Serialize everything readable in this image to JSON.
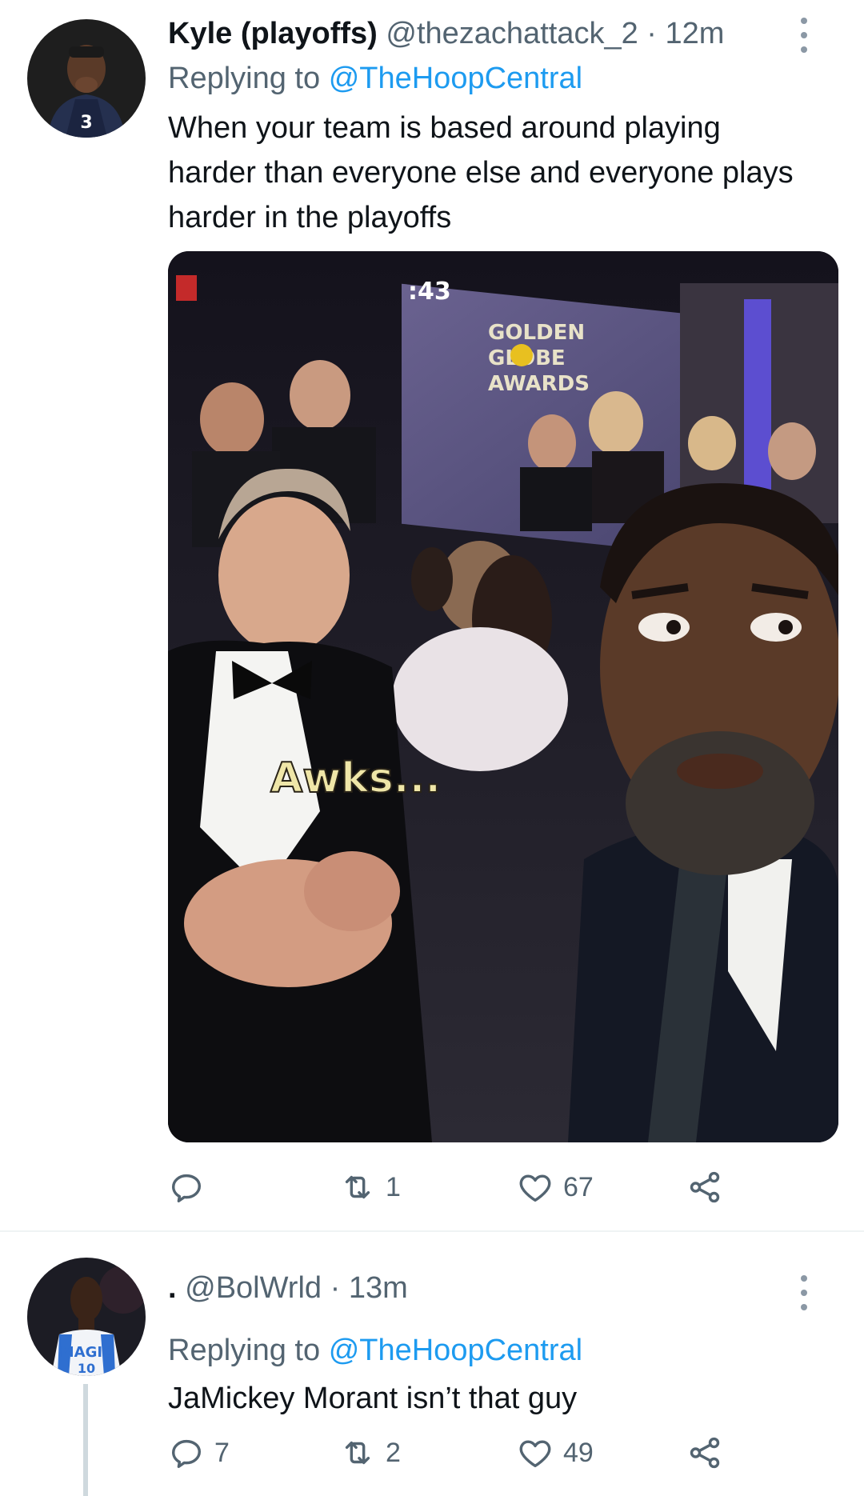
{
  "tweets": [
    {
      "display_name": "Kyle (playoffs)",
      "handle": "@thezachattack_2",
      "separator": "·",
      "time": "12m",
      "replying_label": "Replying to",
      "replying_to": "@TheHoopCentral",
      "text_lines": [
        "When your team is based around playing",
        "harder than everyone else and everyone plays",
        "harder in the playoffs"
      ],
      "media": {
        "screen_text": ":43",
        "screen_logo": [
          "GOLDEN",
          "GLOBE",
          "AWARDS"
        ],
        "caption": "Awks..."
      },
      "actions": {
        "reply_count": "",
        "retweet_count": "1",
        "like_count": "67"
      }
    },
    {
      "display_name": ".",
      "handle": "@BolWrld",
      "separator": "·",
      "time": "13m",
      "replying_label": "Replying to",
      "replying_to": "@TheHoopCentral",
      "text_lines": [
        "JaMickey Morant isn’t that guy"
      ],
      "avatar_jersey_text": "MAGIC",
      "avatar_jersey_number": "10",
      "actions": {
        "reply_count": "7",
        "retweet_count": "2",
        "like_count": "49"
      }
    }
  ],
  "icons": {
    "reply": "reply-icon",
    "retweet": "retweet-icon",
    "like": "heart-icon",
    "share": "share-icon",
    "more": "more-vertical-icon"
  },
  "colors": {
    "text": "#0f1419",
    "secondary": "#536471",
    "link": "#1d9bf0",
    "divider": "#eff3f4",
    "thread_line": "#cfd9de"
  }
}
